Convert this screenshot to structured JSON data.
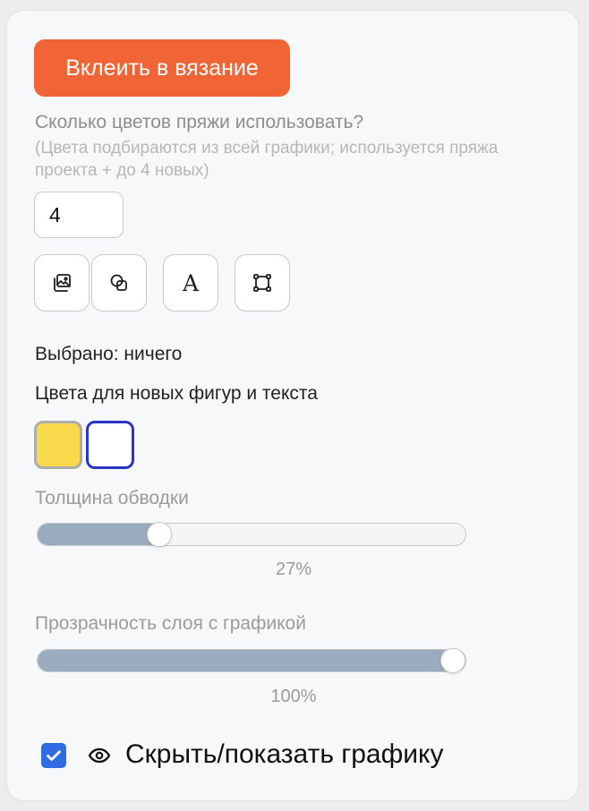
{
  "actions": {
    "embed_label": "Вклеить в вязание"
  },
  "yarn": {
    "question": "Сколько цветов пряжи использовать?",
    "hint": "(Цвета подбираются из всей графики; используется пряжа проекта + до 4 новых)",
    "count_value": "4"
  },
  "tools": [
    {
      "icon": "image-icon"
    },
    {
      "icon": "shapes-icon"
    },
    {
      "icon": "text-icon",
      "glyph": "A"
    },
    {
      "icon": "bounding-box-icon"
    }
  ],
  "selection": {
    "status": "Выбрано: ничего"
  },
  "colors": {
    "heading": "Цвета для новых фигур и текста",
    "fill": "#f8d94b",
    "fill_border": "#adadad",
    "stroke_border": "#2b34c9",
    "stroke": "#ffffff"
  },
  "stroke_width": {
    "label": "Толщина обводки",
    "value": 27,
    "value_text": "27%"
  },
  "opacity": {
    "label": "Прозрачность слоя с графикой",
    "value": 100,
    "value_text": "100%"
  },
  "visibility": {
    "checked": true,
    "label": "Скрыть/показать графику",
    "icon": "eye-icon"
  },
  "theme": {
    "accent": "#f16436",
    "slider_fill": "#9aabbe",
    "checkbox": "#2f6be3"
  }
}
